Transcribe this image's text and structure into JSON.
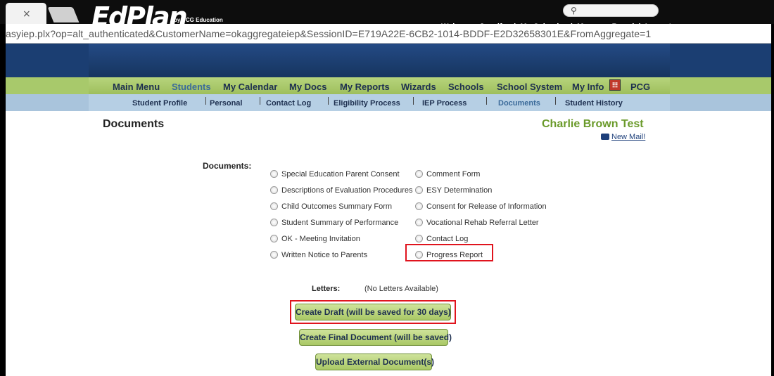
{
  "browser": {
    "tab_close": "×",
    "url": "asyiep.plx?op=alt_authenticated&CustomerName=okaggregateiep&SessionID=E719A22E-6CB2-1014-BDDF-E2D32658301E&FromAggregate=1"
  },
  "header": {
    "logo_text": "EdPlan",
    "logo_sub": "by PCG Education",
    "welcome": "Welcome, Jennifer",
    "links": [
      "My Calendar",
      "Message Board",
      "Logout"
    ],
    "separator": "|"
  },
  "main_nav": [
    {
      "label": "Main Menu",
      "active": false
    },
    {
      "label": "Students",
      "active": true
    },
    {
      "label": "My Calendar",
      "active": false
    },
    {
      "label": "My Docs",
      "active": false
    },
    {
      "label": "My Reports",
      "active": false
    },
    {
      "label": "Wizards",
      "active": false
    },
    {
      "label": "Schools",
      "active": false
    },
    {
      "label": "School System",
      "active": false
    },
    {
      "label": "My Info",
      "active": false
    },
    {
      "label": "PCG",
      "active": false
    }
  ],
  "sub_nav": [
    {
      "label": "Student Profile",
      "active": false
    },
    {
      "label": "Personal",
      "active": false
    },
    {
      "label": "Contact Log",
      "active": false
    },
    {
      "label": "Eligibility Process",
      "active": false
    },
    {
      "label": "IEP Process",
      "active": false
    },
    {
      "label": "Documents",
      "active": true
    },
    {
      "label": "Student History",
      "active": false
    }
  ],
  "content": {
    "page_title": "Documents",
    "student_name": "Charlie Brown Test",
    "new_mail": "New Mail!",
    "documents_label": "Documents:",
    "documents_left": [
      "Special Education Parent Consent",
      "Descriptions of Evaluation Procedures",
      "Child Outcomes Summary Form",
      "Student Summary of Performance",
      "OK - Meeting Invitation",
      "Written Notice to Parents"
    ],
    "documents_right": [
      "Comment Form",
      "ESY Determination",
      "Consent for Release of Information",
      "Vocational Rehab Referral Letter",
      "Contact Log",
      "Progress Report"
    ],
    "letters_label": "Letters:",
    "letters_value": "(No Letters Available)",
    "buttons": {
      "create_draft": "Create Draft (will be saved for 30 days)",
      "create_final": "Create Final Document (will be saved)",
      "upload_external": "Upload External Document(s)"
    }
  },
  "colors": {
    "header_blue": "#1b3e72",
    "nav_green": "#a8c96b",
    "subnav_blue": "#b6cfe4",
    "student_green": "#6a9a2a",
    "highlight_red": "#e0141e"
  }
}
